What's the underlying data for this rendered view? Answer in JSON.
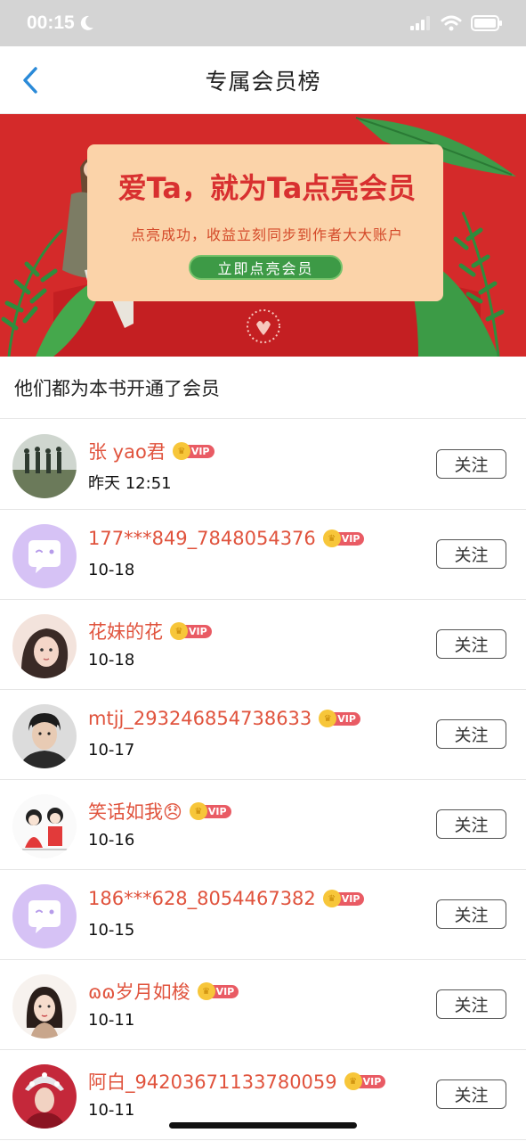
{
  "status_bar": {
    "time": "00:15"
  },
  "nav": {
    "title": "专属会员榜"
  },
  "banner": {
    "title": "爱Ta，就为Ta点亮会员",
    "subtitle": "点亮成功，收益立刻同步到作者大大账户",
    "button_label": "立即点亮会员",
    "colors": {
      "background": "#d42a2a",
      "card": "#fbd3a9",
      "button": "#3d9a46"
    }
  },
  "section": {
    "title": "他们都为本书开通了会员"
  },
  "vip_label": "VIP",
  "follow_label": "关注",
  "members": [
    {
      "name": "张 yao君",
      "date": "昨天 12:51",
      "avatar": "photo-group-avatar"
    },
    {
      "name": "177***849_7848054376",
      "date": "10-18",
      "avatar": "default-chat-avatar"
    },
    {
      "name": "花妹的花",
      "date": "10-18",
      "avatar": "girl-illustration-avatar"
    },
    {
      "name": "mtjj_293246854738633",
      "date": "10-17",
      "avatar": "man-photo-avatar"
    },
    {
      "name": "笑话如我😞",
      "date": "10-16",
      "avatar": "couple-cartoon-avatar"
    },
    {
      "name": "186***628_8054467382",
      "date": "10-15",
      "avatar": "default-chat-avatar"
    },
    {
      "name": "ɷɷ岁月如梭",
      "date": "10-11",
      "avatar": "woman-illustration-avatar"
    },
    {
      "name": "阿白_94203671133780059",
      "date": "10-11",
      "avatar": "costume-photo-avatar"
    }
  ],
  "colors": {
    "username": "#e0533d",
    "vip_tag": "#e95b64",
    "vip_crown": "#f7c63a",
    "default_avatar": "#d6c2f5"
  }
}
